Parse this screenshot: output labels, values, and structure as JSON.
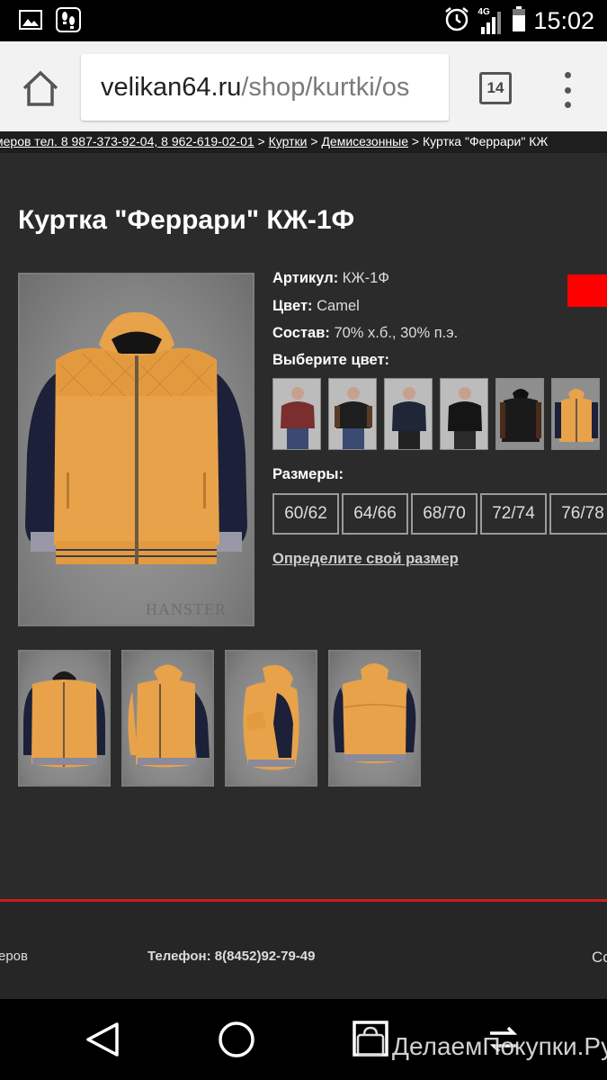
{
  "status_bar": {
    "network": "4G",
    "time": "15:02"
  },
  "browser": {
    "url_domain": "velikan64.ru",
    "url_path": "/shop/kurtki/os",
    "tab_count": "14"
  },
  "breadcrumb": {
    "prefix": "меров тел. 8 987-373-92-04, 8 962-619-02-01",
    "sep": " > ",
    "link1": "Куртки",
    "link2": "Демисезонные",
    "current": "Куртка \"Феррари\" КЖ"
  },
  "product": {
    "title": "Куртка \"Феррари\" КЖ-1Ф",
    "article_label": "Артикул:",
    "article_value": "КЖ-1Ф",
    "color_label": "Цвет:",
    "color_value": "Camel",
    "composition_label": "Состав:",
    "composition_value": "70% х.б., 30% п.э.",
    "choose_color_label": "Выберите цвет:",
    "sizes_label": "Размеры:",
    "sizes": [
      "60/62",
      "64/66",
      "68/70",
      "72/74",
      "76/78"
    ],
    "size_guide_link": "Определите свой размер",
    "photo_watermark": "HANSTER"
  },
  "footer": {
    "left_text": "еров",
    "phone_label": "Телефон:",
    "phone_value": "8(8452)92-79-49",
    "right_text": "Со"
  },
  "watermark": "ДелаемПокупки.Ру",
  "colors": {
    "background": "#2b2b2b",
    "accent_red": "#ff0000",
    "footer_line": "#cc1d1d",
    "jacket_camel": "#e8a24a",
    "sleeve_navy": "#1c2038"
  }
}
